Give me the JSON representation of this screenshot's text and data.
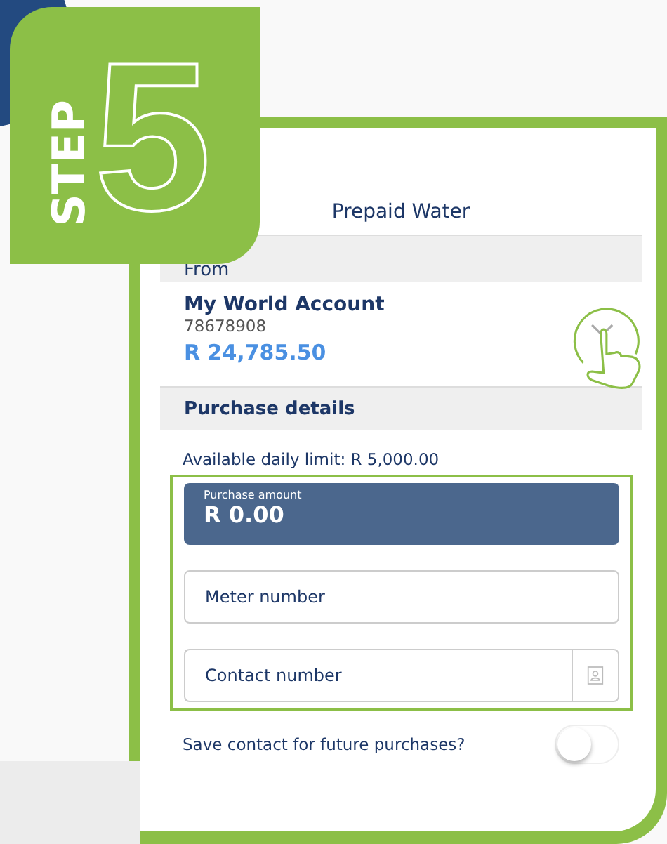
{
  "badge": {
    "word": "STEP",
    "number": "5"
  },
  "screen": {
    "title": "Prepaid Water"
  },
  "from": {
    "heading": "From",
    "account_name": "My World Account",
    "account_number": "78678908",
    "balance": "R 24,785.50"
  },
  "purchase": {
    "heading": "Purchase details",
    "limit": "Available daily limit: R 5,000.00",
    "amount": {
      "label": "Purchase amount",
      "value": "R 0.00"
    },
    "meter": {
      "placeholder": "Meter number"
    },
    "contact": {
      "placeholder": "Contact number"
    },
    "save_contact": {
      "label": "Save contact for future purchases?",
      "on": false
    }
  }
}
